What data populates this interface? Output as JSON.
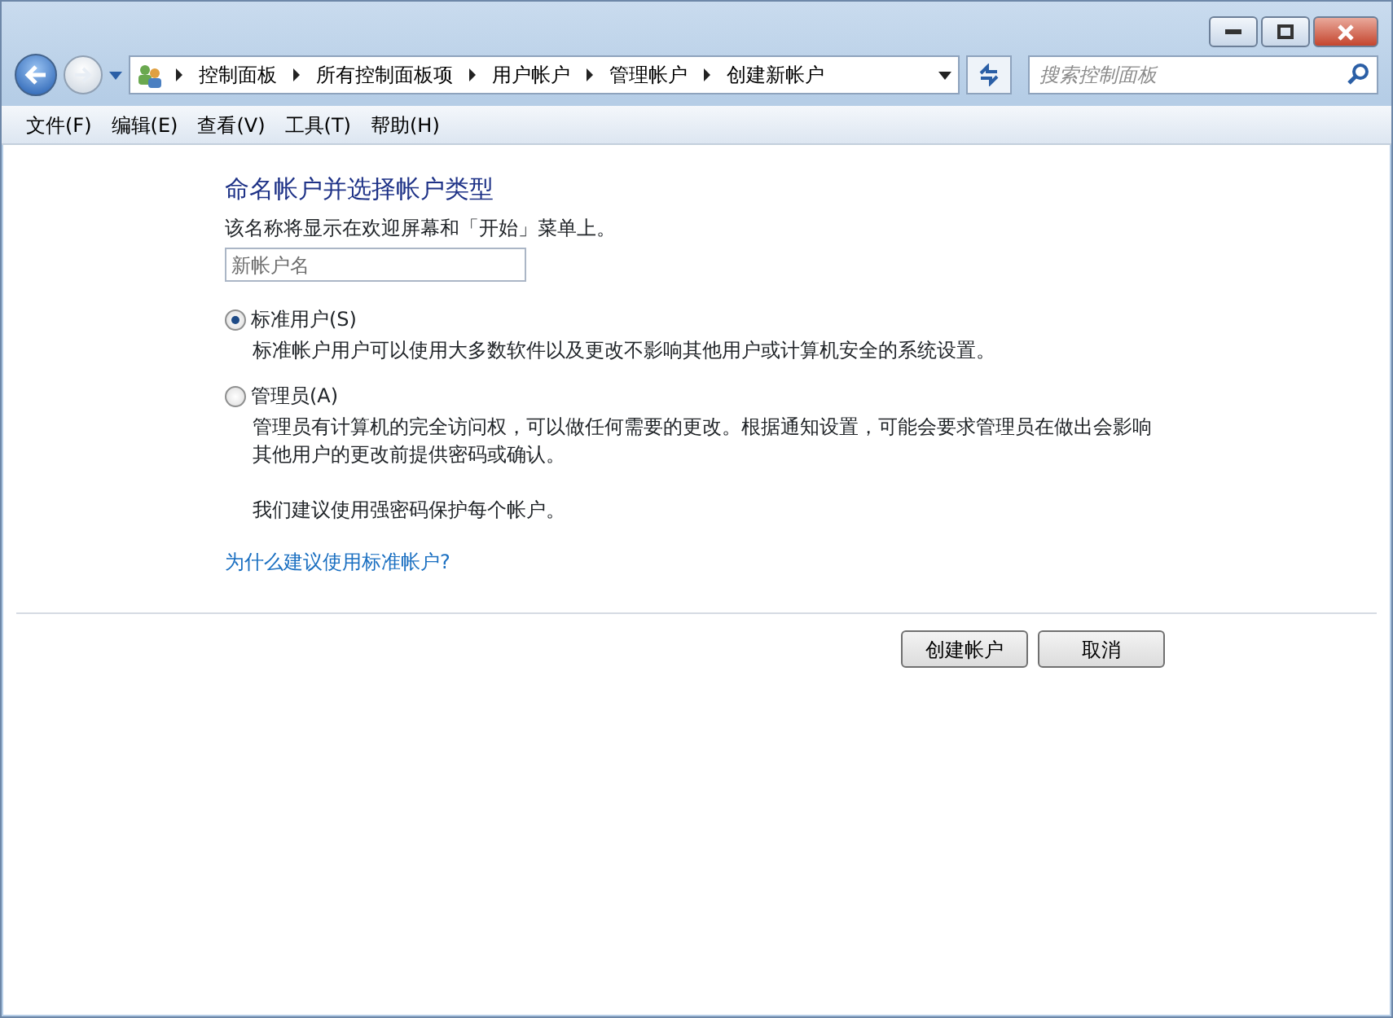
{
  "breadcrumb": [
    "控制面板",
    "所有控制面板项",
    "用户帐户",
    "管理帐户",
    "创建新帐户"
  ],
  "search": {
    "placeholder": "搜索控制面板"
  },
  "menu": [
    "文件(F)",
    "编辑(E)",
    "查看(V)",
    "工具(T)",
    "帮助(H)"
  ],
  "heading": "命名帐户并选择帐户类型",
  "name_hint": "该名称将显示在欢迎屏幕和「开始」菜单上。",
  "name_field": {
    "placeholder": "新帐户名"
  },
  "account_types": [
    {
      "label": "标准用户(S)",
      "selected": true,
      "description": [
        "标准帐户用户可以使用大多数软件以及更改不影响其他用户或计算机安全的系统设置。"
      ]
    },
    {
      "label": "管理员(A)",
      "selected": false,
      "description": [
        "管理员有计算机的完全访问权，可以做任何需要的更改。根据通知设置，可能会要求管理员在做出会影响其他用户的更改前提供密码或确认。",
        "我们建议使用强密码保护每个帐户。"
      ]
    }
  ],
  "help_link": "为什么建议使用标准帐户?",
  "buttons": [
    "创建帐户",
    "取消"
  ]
}
